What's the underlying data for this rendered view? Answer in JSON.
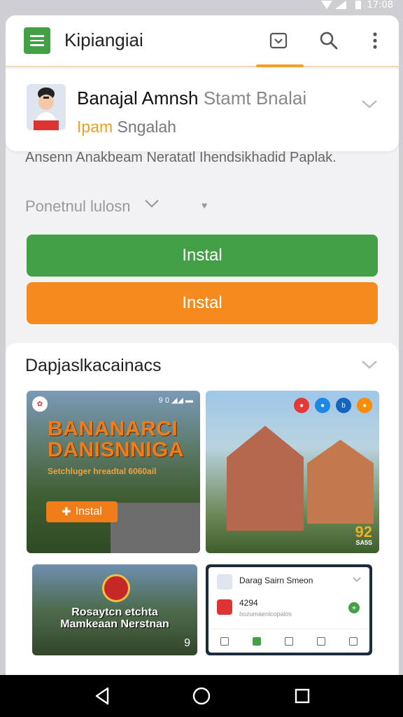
{
  "status_bar": {
    "time": "17:08"
  },
  "app_bar": {
    "title": "Kipiangiai",
    "icons": [
      "menu-icon",
      "inbox-icon",
      "search-icon",
      "more-vert-icon"
    ]
  },
  "app": {
    "name": "Banajal Amnsh",
    "name_suffix": "Stamt Bnalai",
    "developer": "Ipam",
    "developer_suffix": "Sngalah",
    "description": "Ansenn Anakbeam Neratatl Ihendsikhadid Paplak."
  },
  "dropdown": {
    "label": "Ponetnul lulosn"
  },
  "buttons": {
    "install_primary": "Instal",
    "install_secondary": "Instal"
  },
  "section": {
    "title": "Dapjaslkacainacs",
    "screenshots": {
      "s1": {
        "status": "9 0 ◢◢ ▬",
        "title": "BANANARCI DANISNNIGA",
        "subtitle": "Setchluger hreadtal 6060ail",
        "button": "Instal"
      },
      "s2": {
        "corner_number": "92",
        "corner_text": "SA5S"
      },
      "s3": {
        "text": "Rosaytcn etchta Mamkeaan Nerstnan",
        "corner": "9"
      },
      "s4": {
        "name": "Darag Sairn Smeon",
        "line1": "4294",
        "line2": "bozumaenlcopalos"
      }
    }
  },
  "colors": {
    "green": "#43a047",
    "orange": "#f58a1f",
    "accent_text": "#f0a020"
  }
}
